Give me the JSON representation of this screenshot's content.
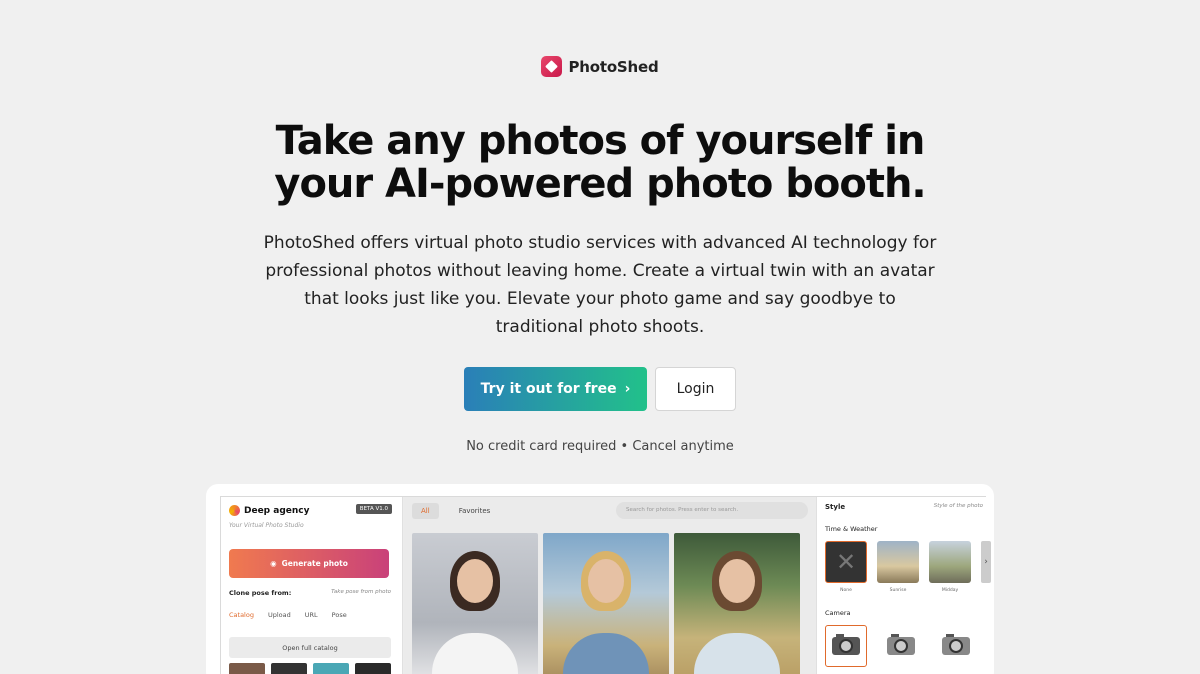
{
  "brand": {
    "name": "PhotoShed"
  },
  "hero": {
    "title_line1": "Take any photos of yourself in",
    "title_line2": "your AI-powered photo booth.",
    "subtitle": "PhotoShed offers virtual photo studio services with advanced AI technology for professional photos without leaving home. Create a virtual twin with an avatar that looks just like you. Elevate your photo game and say goodbye to traditional photo shoots."
  },
  "cta": {
    "primary_label": "Try it out for free",
    "primary_icon": "chevron-right-icon",
    "secondary_label": "Login",
    "note": "No credit card required • Cancel anytime"
  },
  "preview": {
    "left": {
      "brand_name": "Deep agency",
      "brand_tagline": "Your Virtual Photo Studio",
      "beta_badge": "BETA V1.0",
      "generate_label": "Generate photo",
      "clone_title": "Clone pose from:",
      "clone_hint": "Take pose from photo",
      "tabs": [
        "Catalog",
        "Upload",
        "URL",
        "Pose"
      ],
      "catalog_button": "Open full catalog"
    },
    "middle": {
      "tabs": [
        "All",
        "Favorites"
      ],
      "search_placeholder": "Search for photos. Press enter to search."
    },
    "right": {
      "style_title": "Style",
      "style_hint": "Style of the photo",
      "time_weather_label": "Time & Weather",
      "time_weather_options": [
        "None",
        "Sunrise",
        "Midday"
      ],
      "camera_label": "Camera"
    }
  },
  "colors": {
    "accent_gradient_start": "#2a7fb8",
    "accent_gradient_end": "#22c18a",
    "brand_red": "#e8476b",
    "orange_accent": "#e06a2c"
  }
}
